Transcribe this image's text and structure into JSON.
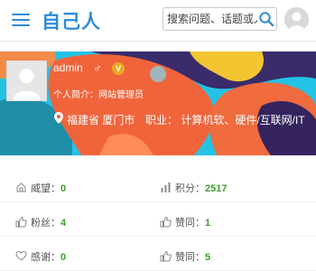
{
  "header": {
    "logo_text": "自己人",
    "search_placeholder": "搜索问题、话题或人",
    "brand_color": "#2e8bd6"
  },
  "profile": {
    "username": "admin",
    "gender_symbol": "♂",
    "vip_badge": "V",
    "intro": "个人简介：网站管理员",
    "location": "福建省 厦门市",
    "job": "职业： 计算机软、硬件/互联网/IT"
  },
  "stats": [
    {
      "label": "威望：",
      "value": "0",
      "icon": "prestige-icon"
    },
    {
      "label": "积分：",
      "value": "2517",
      "icon": "points-icon"
    },
    {
      "label": "粉丝：",
      "value": "4",
      "icon": "fans-icon"
    },
    {
      "label": "赞同：",
      "value": "1",
      "icon": "agree-icon"
    },
    {
      "label": "感谢：",
      "value": "0",
      "icon": "thanks-icon"
    },
    {
      "label": "赞同：",
      "value": "5",
      "icon": "agree-icon"
    }
  ],
  "value_color": "#3f9c2e"
}
